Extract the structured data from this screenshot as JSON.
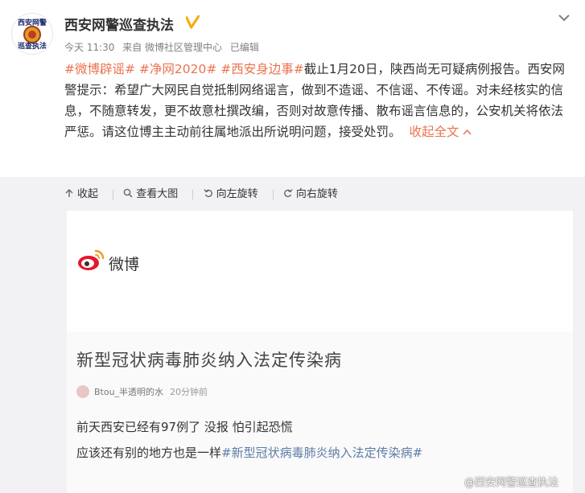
{
  "avatar": {
    "line1": "西安网警",
    "line2": "巡查执法"
  },
  "post": {
    "author": "西安网警巡查执法",
    "time": "今天 11:30",
    "source": "来自 微博社区管理中心",
    "edited": "已编辑",
    "tags": [
      "#微博辟谣#",
      "#净网2020#",
      "#西安身边事#"
    ],
    "text": "截止1月20日，陕西尚无可疑病例报告。西安网警提示：希望广大网民自觉抵制网络谣言，做到不造谣、不信谣、不传谣。对未经核实的信息，不随意转发，更不故意杜撰改编，否则对故意传播、散布谣言信息的，公安机关将依法严惩。请这位博主主动前往属地派出所说明问题，接受处罚。",
    "collapse": "收起全文"
  },
  "toolbar": {
    "collapse": "收起",
    "view_large": "查看大图",
    "rotate_left": "向左旋转",
    "rotate_right": "向右旋转"
  },
  "image": {
    "logo_text": "微博",
    "headline": "新型冠状病毒肺炎纳入法定传染病",
    "author": "Btou_半透明的水",
    "time": "20分钟前",
    "line1": "前天西安已经有97例了 没报 怕引起恐慌",
    "line2_prefix": "应该还有别的地方也是一样",
    "line2_tag": "#新型冠状病毒肺炎纳入法定传染病#",
    "watermark": "@西安网警巡查执法"
  },
  "colors": {
    "tag": "#eb7350",
    "verify": "#f6ab00",
    "link_blue": "#5c7ca6"
  }
}
